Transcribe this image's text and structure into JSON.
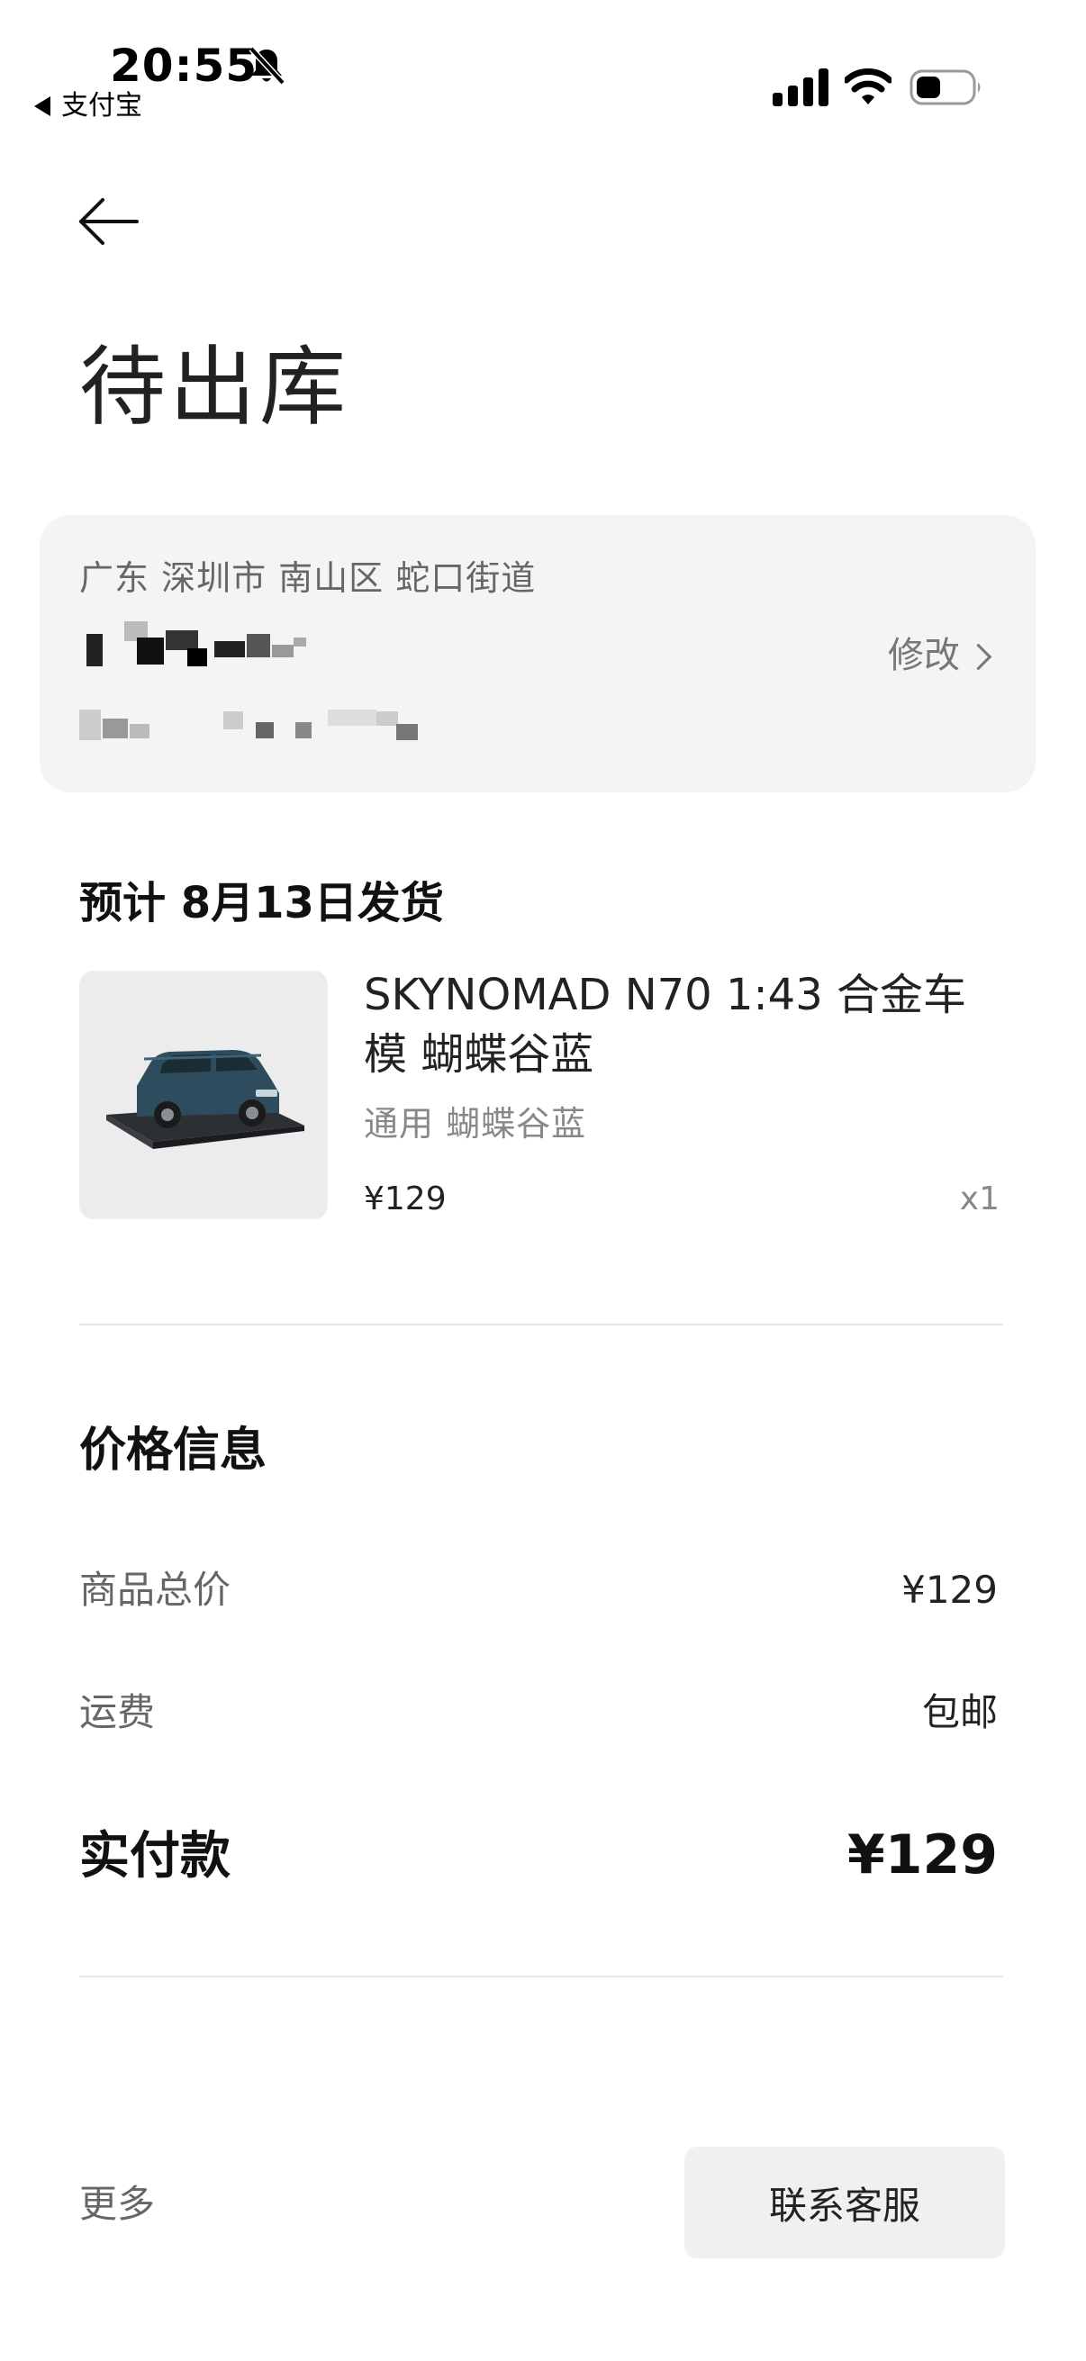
{
  "status_bar": {
    "time": "20:55",
    "back_app_label": "支付宝",
    "icons": [
      "bell-muted-icon",
      "cellular-signal-icon",
      "wifi-icon",
      "battery-icon"
    ]
  },
  "header": {
    "back_icon": "arrow-left-icon",
    "title": "待出库"
  },
  "address": {
    "region": "广东 深圳市 南山区 蛇口街道",
    "edit_label": "修改",
    "edit_icon": "chevron-right-icon"
  },
  "shipment": {
    "estimate": "预计 8月13日发货",
    "product": {
      "name": "SKYNOMAD N70 1:43 合金车模 蝴蝶谷蓝",
      "spec": "通用 蝴蝶谷蓝",
      "price": "¥129",
      "quantity": "x1"
    }
  },
  "price_info": {
    "title": "价格信息",
    "rows": [
      {
        "label": "商品总价",
        "value": "¥129"
      },
      {
        "label": "运费",
        "value": "包邮"
      }
    ],
    "total_label": "实付款",
    "total_value": "¥129"
  },
  "footer": {
    "more_label": "更多",
    "contact_label": "联系客服"
  },
  "colors": {
    "card_background": "#f4f4f4",
    "button_background": "#f0f0f0",
    "secondary_text": "#666666",
    "car_body": "#2d4d5e"
  }
}
